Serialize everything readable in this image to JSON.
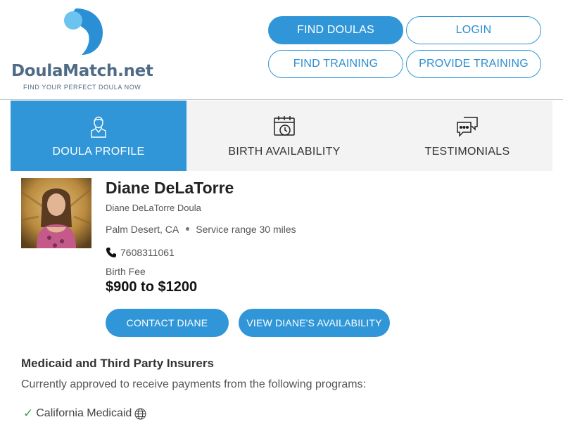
{
  "brand": {
    "name_part1": "Doula",
    "name_part2": "Match.net",
    "tagline": "FIND YOUR PERFECT DOULA NOW",
    "colors": {
      "accent": "#3096d8",
      "logo_light": "#6cc3f0",
      "logo_dark": "#2b8fd6",
      "text": "#4f6b86"
    }
  },
  "nav": {
    "find_doulas": "FIND DOULAS",
    "login": "LOGIN",
    "find_training": "FIND TRAINING",
    "provide_training": "PROVIDE TRAINING"
  },
  "tabs": [
    {
      "label": "DOULA PROFILE",
      "icon": "person-icon",
      "active": true
    },
    {
      "label": "BIRTH AVAILABILITY",
      "icon": "calendar-clock-icon",
      "active": false
    },
    {
      "label": "TESTIMONIALS",
      "icon": "chat-bubbles-icon",
      "active": false
    }
  ],
  "profile": {
    "name": "Diane DeLaTorre",
    "business": "Diane DeLaTorre Doula",
    "location": "Palm Desert, CA",
    "service_range": "Service range 30 miles",
    "phone": "7608311061",
    "fee_label": "Birth Fee",
    "fee": "$900 to $1200",
    "contact_button": "CONTACT DIANE",
    "availability_button": "VIEW DIANE'S AVAILABILITY"
  },
  "insurance": {
    "title": "Medicaid and Third Party Insurers",
    "description": "Currently approved to receive payments from the following programs:",
    "programs": [
      "California Medicaid"
    ]
  }
}
